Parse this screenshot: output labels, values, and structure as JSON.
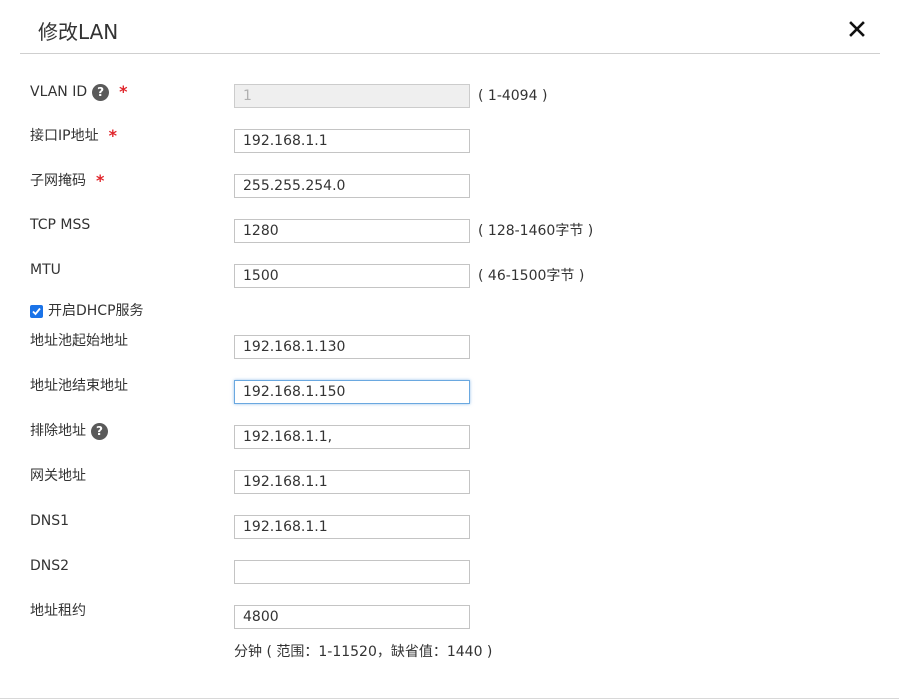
{
  "dialog": {
    "title": "修改LAN",
    "close_icon": "close-icon"
  },
  "fields": {
    "vlan_id": {
      "label": "VLAN ID",
      "value": "1",
      "hint": "( 1-4094 )",
      "required": true,
      "help_icon": "question-icon"
    },
    "interface_ip": {
      "label": "接口IP地址",
      "value": "192.168.1.1",
      "required": true
    },
    "subnet_mask": {
      "label": "子网掩码",
      "value": "255.255.254.0",
      "required": true
    },
    "tcp_mss": {
      "label": "TCP MSS",
      "value": "1280",
      "hint": "( 128-1460字节 )"
    },
    "mtu": {
      "label": "MTU",
      "value": "1500",
      "hint": "( 46-1500字节 )"
    },
    "dhcp": {
      "label": "开启DHCP服务",
      "checked": true
    },
    "pool_start": {
      "label": "地址池起始地址",
      "value": "192.168.1.130"
    },
    "pool_end": {
      "label": "地址池结束地址",
      "value": "192.168.1.150"
    },
    "exclude": {
      "label": "排除地址",
      "value": "192.168.1.1,",
      "help_icon": "question-icon"
    },
    "gateway": {
      "label": "网关地址",
      "value": "192.168.1.1"
    },
    "dns1": {
      "label": "DNS1",
      "value": "192.168.1.1"
    },
    "dns2": {
      "label": "DNS2",
      "value": ""
    },
    "lease": {
      "label": "地址租约",
      "value": "4800",
      "hint": "分钟 ( 范围：1-11520，缺省值：1440 )"
    }
  },
  "required_mark": "*",
  "help_mark": "?",
  "colors": {
    "required": "#e0242a",
    "checkbox": "#1a73e8",
    "focus_border": "#6aa8e0"
  }
}
